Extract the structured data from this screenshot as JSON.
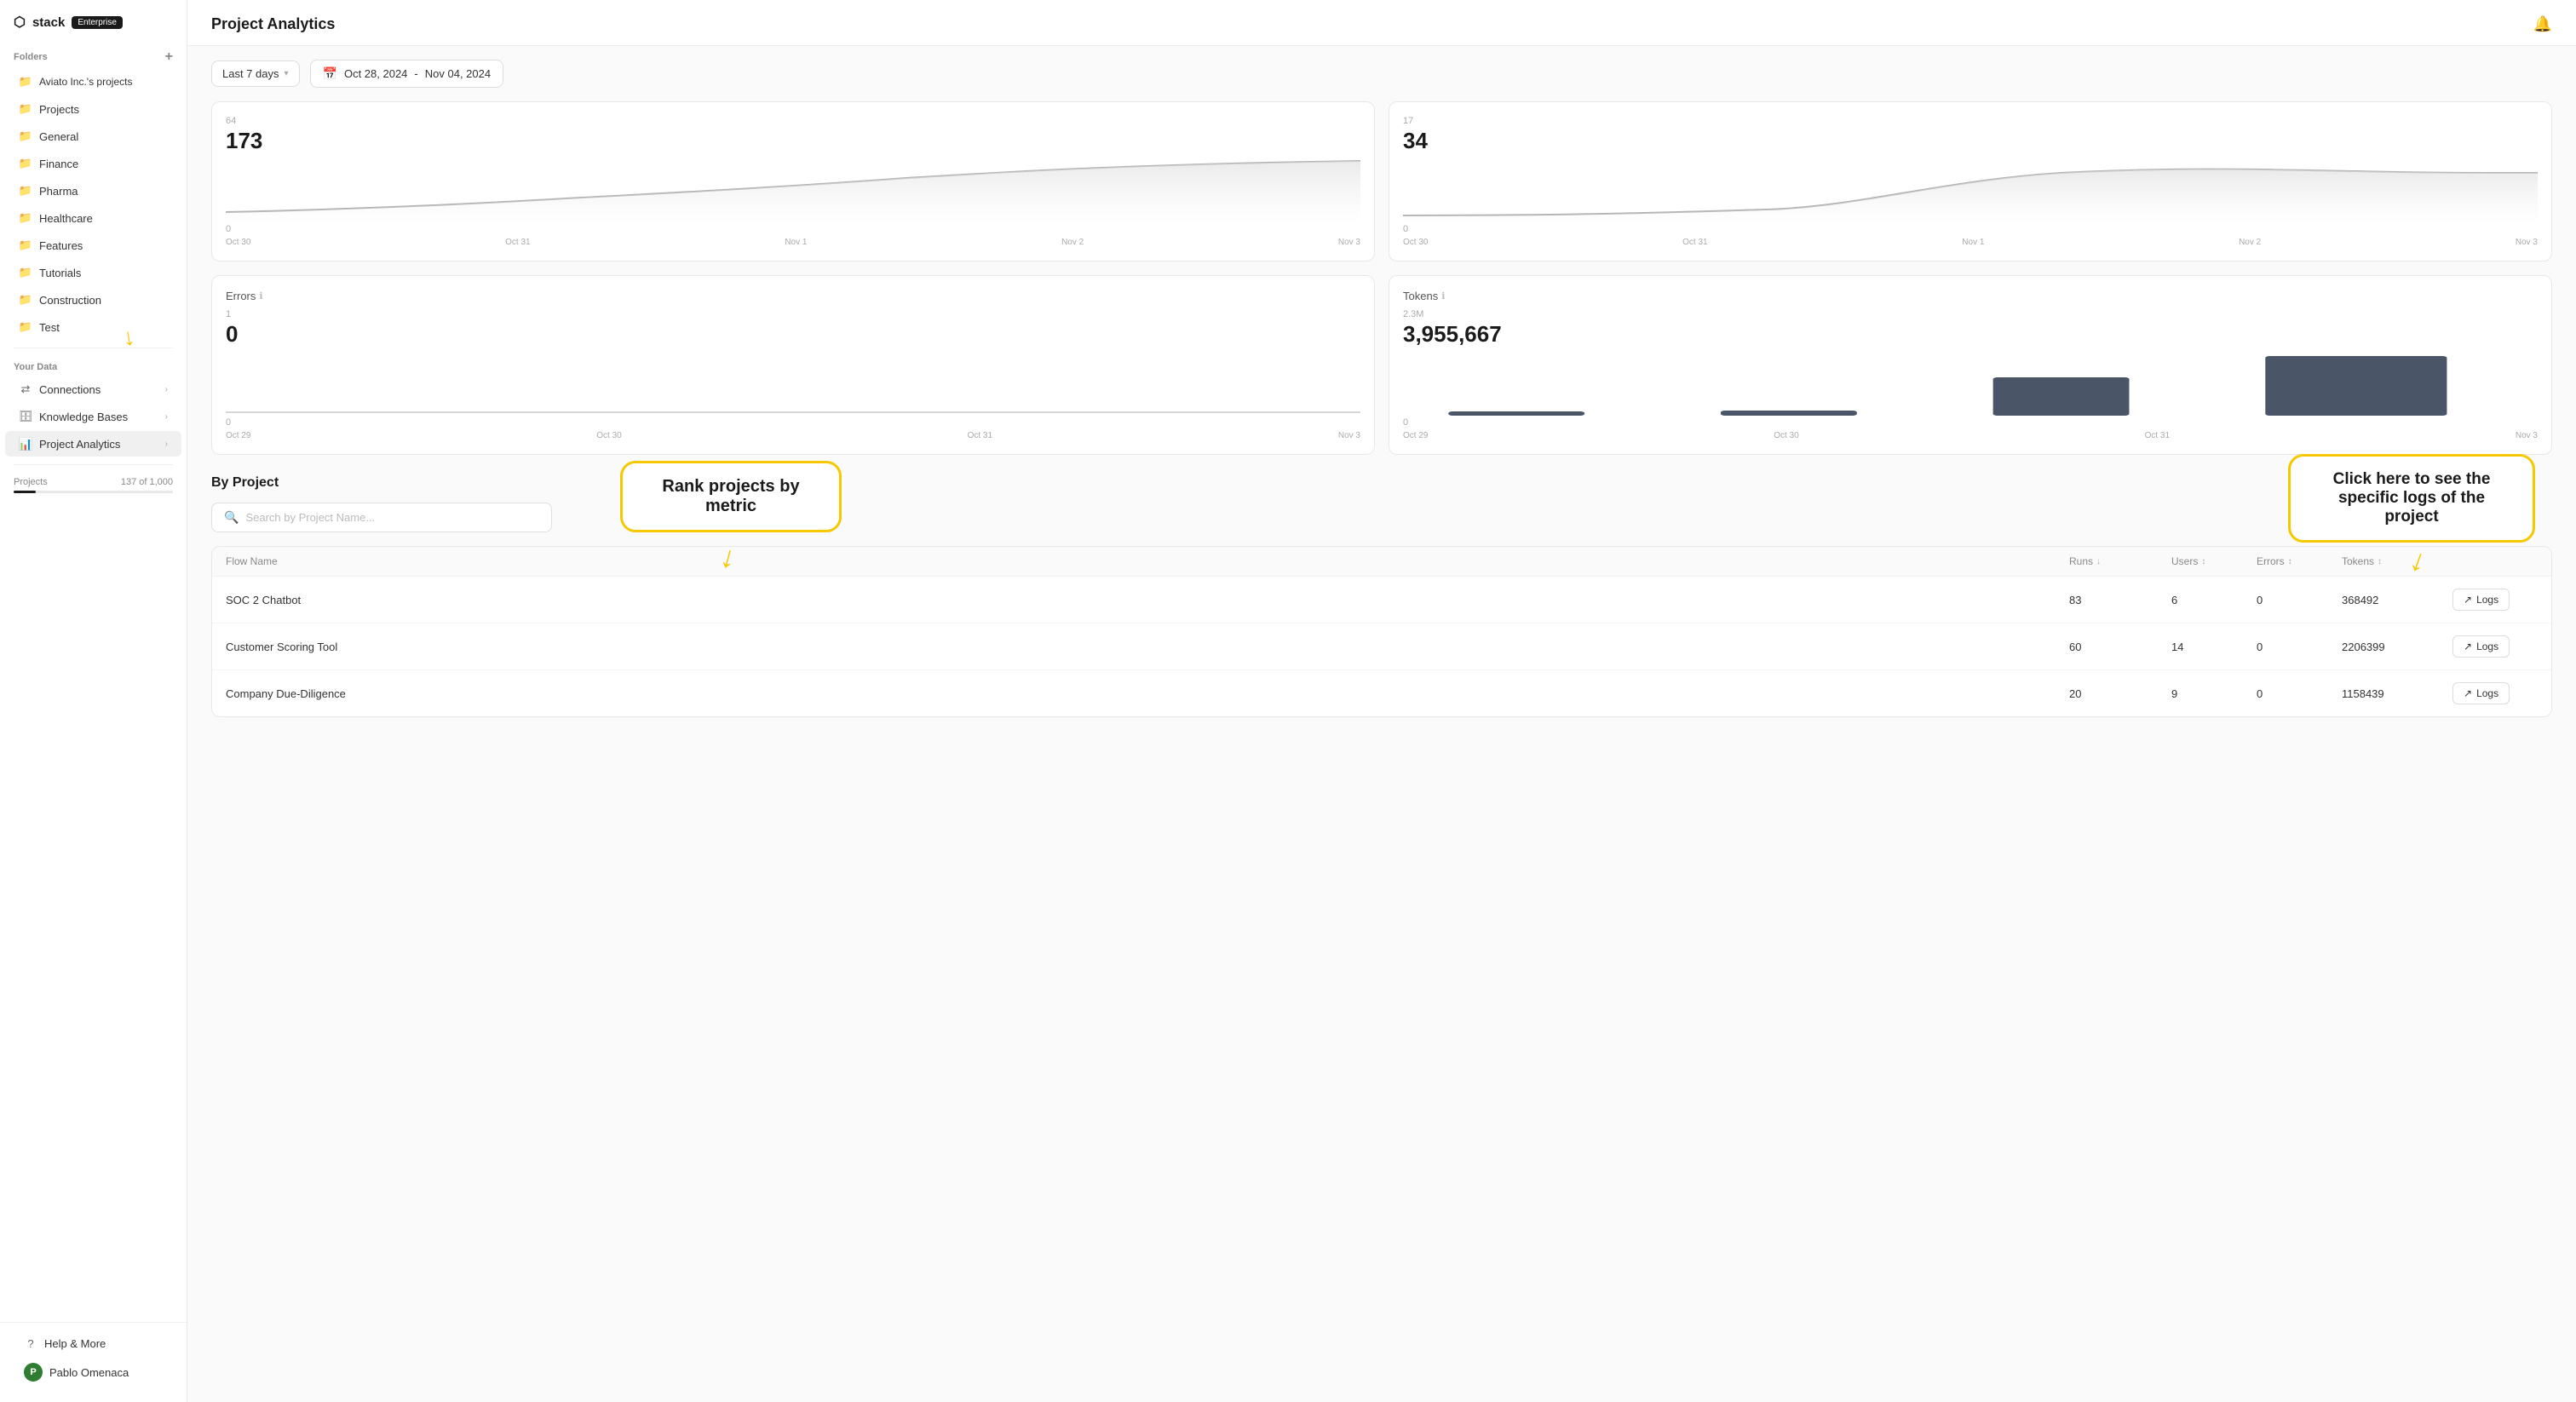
{
  "app": {
    "logo": "stack",
    "badge": "Enterprise",
    "bell_icon": "🔔"
  },
  "sidebar": {
    "folders_label": "Folders",
    "add_icon": "+",
    "folders": [
      {
        "label": "Aviato Inc.'s projects",
        "icon": "folder"
      },
      {
        "label": "Projects",
        "icon": "folder"
      },
      {
        "label": "General",
        "icon": "folder"
      },
      {
        "label": "Finance",
        "icon": "folder"
      },
      {
        "label": "Pharma",
        "icon": "folder"
      },
      {
        "label": "Healthcare",
        "icon": "folder"
      },
      {
        "label": "Features",
        "icon": "folder"
      },
      {
        "label": "Tutorials",
        "icon": "folder"
      },
      {
        "label": "Construction",
        "icon": "folder"
      },
      {
        "label": "Test",
        "icon": "folder"
      }
    ],
    "your_data_label": "Your Data",
    "data_items": [
      {
        "label": "Connections",
        "icon": "connections",
        "has_chevron": true
      },
      {
        "label": "Knowledge Bases",
        "icon": "knowledge",
        "has_chevron": true
      },
      {
        "label": "Project Analytics",
        "icon": "analytics",
        "has_chevron": true,
        "active": true
      }
    ],
    "projects_label": "Projects",
    "projects_count": "137 of 1,000",
    "footer_items": [
      {
        "label": "Help & More",
        "icon": "help"
      },
      {
        "label": "Pablo Omenaca",
        "icon": "avatar",
        "avatar_letter": "P",
        "avatar_color": "#2e7d32"
      }
    ]
  },
  "main": {
    "title": "Project Analytics",
    "date_preset": "Last 7 days",
    "date_range_start": "Oct 28, 2024",
    "date_range_separator": "-",
    "date_range_end": "Nov 04, 2024",
    "charts": [
      {
        "id": "runs",
        "value": "173",
        "max_label": "64",
        "zero_label": "0",
        "x_labels": [
          "Oct 30",
          "Oct 31",
          "Nov 1",
          "Nov 2",
          "Nov 3"
        ],
        "type": "line"
      },
      {
        "id": "users",
        "value": "34",
        "max_label": "17",
        "zero_label": "0",
        "x_labels": [
          "Oct 30",
          "Oct 31",
          "Nov 1",
          "Nov 2",
          "Nov 3"
        ],
        "type": "line"
      },
      {
        "id": "errors",
        "title": "Errors",
        "value": "0",
        "max_label": "1",
        "zero_label": "0",
        "x_labels": [
          "Oct 29",
          "Oct 30",
          "Oct 31",
          "Nov 3"
        ],
        "type": "line"
      },
      {
        "id": "tokens",
        "title": "Tokens",
        "value": "3,955,667",
        "max_label": "2.3M",
        "zero_label": "0",
        "x_labels": [
          "Oct 29",
          "Oct 30",
          "Oct 31",
          "Nov 3"
        ],
        "type": "bar"
      }
    ],
    "by_project": {
      "title": "By Project",
      "search_placeholder": "Search by Project Name...",
      "columns": [
        {
          "label": "Flow Name",
          "sortable": false
        },
        {
          "label": "Runs",
          "sortable": true,
          "sort": "desc"
        },
        {
          "label": "Users",
          "sortable": true
        },
        {
          "label": "Errors",
          "sortable": true
        },
        {
          "label": "Tokens",
          "sortable": true
        },
        {
          "label": "",
          "sortable": false
        }
      ],
      "rows": [
        {
          "name": "SOC 2 Chatbot",
          "runs": 83,
          "users": 6,
          "errors": 0,
          "tokens": 368492
        },
        {
          "name": "Customer Scoring Tool",
          "runs": 60,
          "users": 14,
          "errors": 0,
          "tokens": 2206399
        },
        {
          "name": "Company Due-Diligence",
          "runs": 20,
          "users": 9,
          "errors": 0,
          "tokens": 1158439
        }
      ],
      "logs_button_label": "Logs"
    },
    "annotations": {
      "rank_bubble": "Rank projects by metric",
      "logs_bubble": "Click here to see the specific logs of the project"
    }
  }
}
